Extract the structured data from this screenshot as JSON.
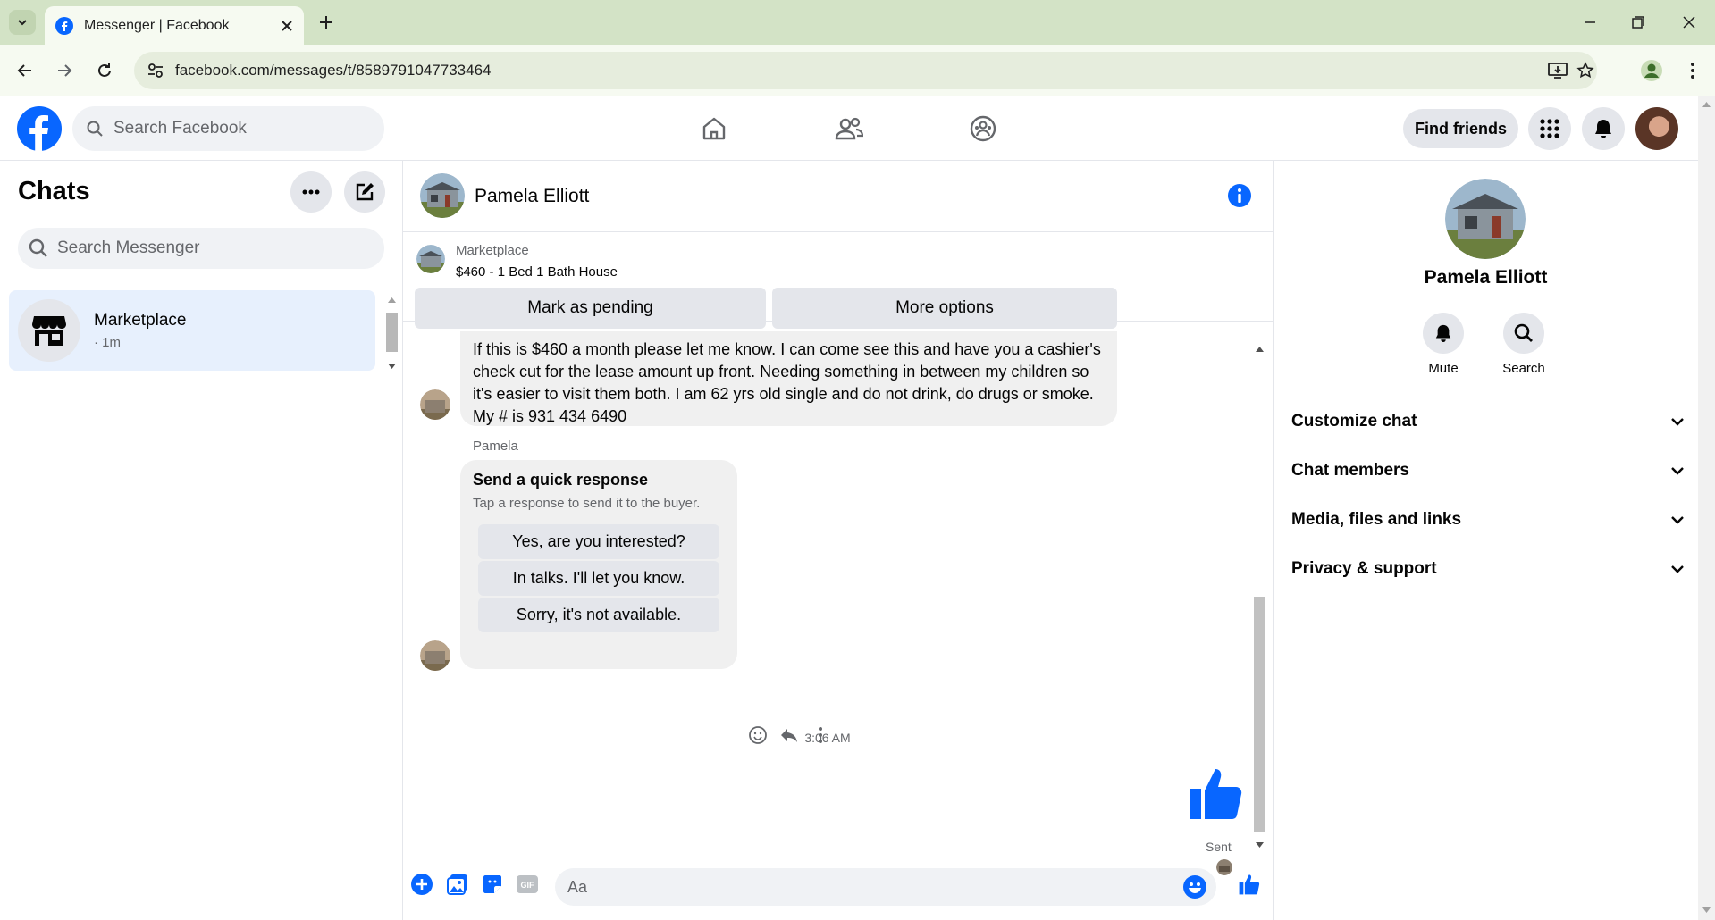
{
  "browser": {
    "tab_title": "Messenger | Facebook",
    "url": "facebook.com/messages/t/8589791047733464"
  },
  "header": {
    "search_placeholder": "Search Facebook",
    "find_friends": "Find friends"
  },
  "chats": {
    "title": "Chats",
    "search_placeholder": "Search Messenger",
    "items": [
      {
        "name": "Marketplace",
        "time": "· 1m"
      }
    ]
  },
  "conversation": {
    "name": "Pamela Elliott",
    "listing": {
      "source": "Marketplace",
      "title": "$460 - 1 Bed 1 Bath House",
      "mark_pending": "Mark as pending",
      "more_options": "More options"
    },
    "messages": {
      "long_text": "If this is $460 a month please let me know. I can come see this and have you a cashier's check cut for the lease amount up front.  Needing something in between my children so it's easier to visit them both. I am 62 yrs old single and do not drink, do drugs or smoke.  My # is 931 434 6490",
      "sender": "Pamela",
      "quick_title": "Send a quick response",
      "quick_sub": "Tap a response to send it to the buyer.",
      "quick_options": [
        "Yes, are you interested?",
        "In talks. I'll let you know.",
        "Sorry, it's not available."
      ],
      "timestamp": "3:06 AM",
      "status": "Sent"
    },
    "composer_placeholder": "Aa"
  },
  "info_panel": {
    "name": "Pamela Elliott",
    "mute": "Mute",
    "search": "Search",
    "sections": [
      "Customize chat",
      "Chat members",
      "Media, files and links",
      "Privacy & support"
    ]
  },
  "colors": {
    "brand": "#0866ff",
    "selected_chat": "#e7f0fd",
    "bubble": "#f0f0f0"
  }
}
